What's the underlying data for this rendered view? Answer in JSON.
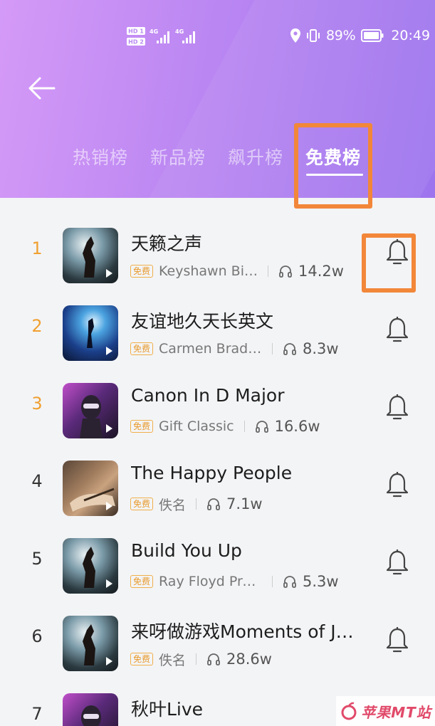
{
  "status_bar": {
    "battery_percent": "89%",
    "time": "20:49",
    "hd1": "HD 1",
    "hd2": "HD 2",
    "net1": "4G",
    "net2": "4G"
  },
  "nav": {
    "back_icon": "arrow-left-icon"
  },
  "tabs": [
    {
      "label": "热销榜",
      "active": false
    },
    {
      "label": "新品榜",
      "active": false
    },
    {
      "label": "飙升榜",
      "active": false
    },
    {
      "label": "免费榜",
      "active": true
    }
  ],
  "songs": [
    {
      "rank": "1",
      "title": "天籁之声",
      "badge": "免费",
      "artist": "Keyshawn Bi…",
      "plays": "14.2w"
    },
    {
      "rank": "2",
      "title": "友谊地久天长英文",
      "badge": "免费",
      "artist": "Carmen Bradf…",
      "plays": "8.3w"
    },
    {
      "rank": "3",
      "title": "Canon In D Major",
      "badge": "免费",
      "artist": "Gift Classic",
      "plays": "16.6w"
    },
    {
      "rank": "4",
      "title": "The Happy People",
      "badge": "免费",
      "artist": "佚名",
      "plays": "7.1w"
    },
    {
      "rank": "5",
      "title": "Build You Up",
      "badge": "免费",
      "artist": "Ray Floyd Pro…",
      "plays": "5.3w"
    },
    {
      "rank": "6",
      "title": "来呀做游戏Moments of J…",
      "badge": "免费",
      "artist": "佚名",
      "plays": "28.6w"
    },
    {
      "rank": "7",
      "title": "秋叶Live",
      "badge": "",
      "artist": "",
      "plays": ""
    }
  ],
  "colors": {
    "header_start": "#d59af7",
    "header_end": "#9d74ee",
    "top_rank": "#f0a030",
    "badge": "#e89a2c",
    "highlight": "#f2873a"
  },
  "watermark": "苹果MT站"
}
